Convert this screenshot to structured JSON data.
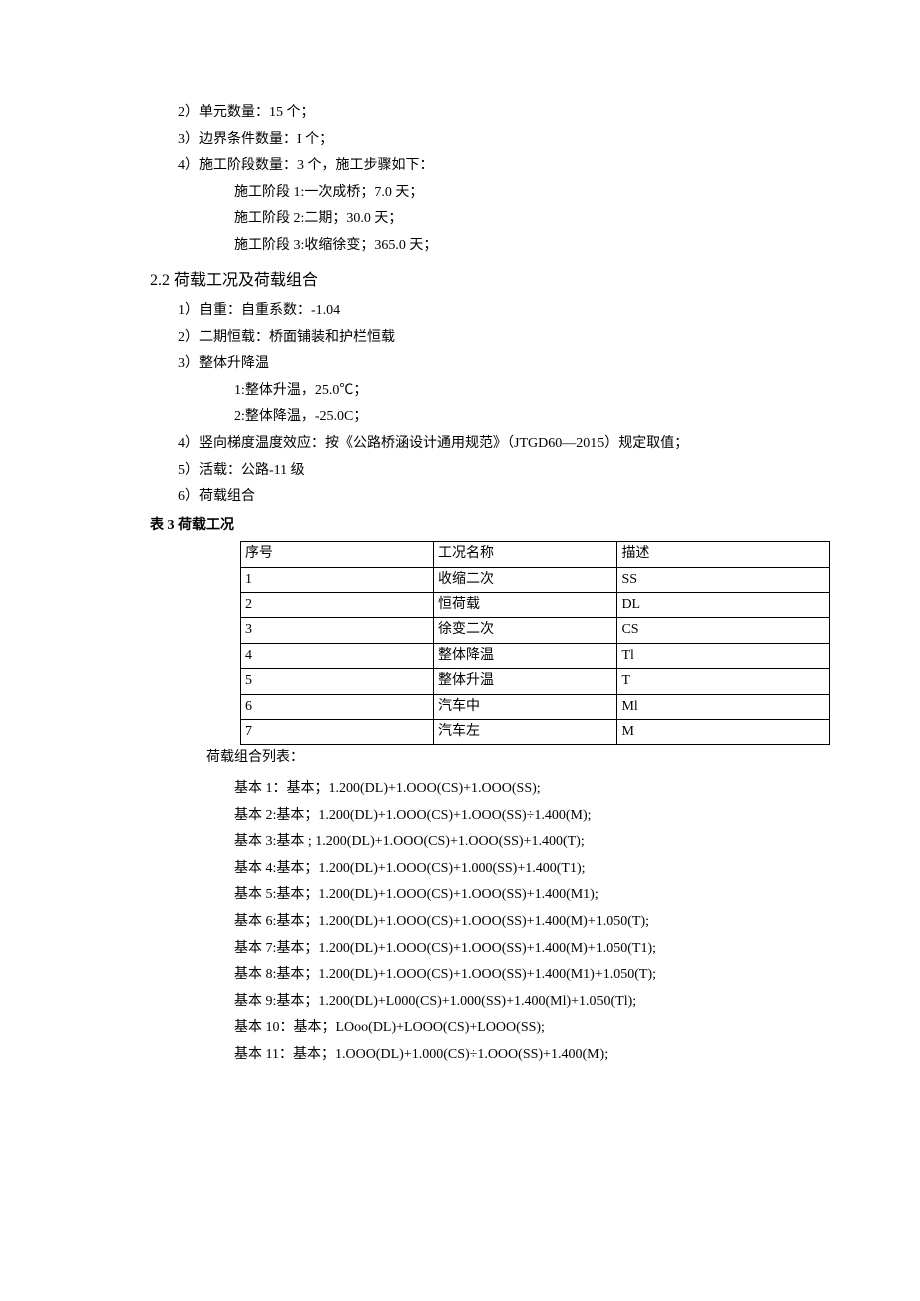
{
  "top": {
    "l1": "2）单元数量：15 个；",
    "l2": "3）边界条件数量：I 个；",
    "l3": "4）施工阶段数量：3 个，施工步骤如下：",
    "l3a": "施工阶段 1:一次成桥；7.0 天；",
    "l3b": "施工阶段 2:二期；30.0 天；",
    "l3c": "施工阶段 3:收缩徐变；365.0 天；"
  },
  "section_heading": "2.2 荷载工况及荷载组合",
  "loads": {
    "l1": "1）自重：自重系数：-1.04",
    "l2": "2）二期恒载：桥面铺装和护栏恒载",
    "l3": "3）整体升降温",
    "l3a": "1:整体升温，25.0℃；",
    "l3b": "2:整体降温，-25.0C；",
    "l4": "4）竖向梯度温度效应：按《公路桥涵设计通用规范》（JTGD60—2015）规定取值；",
    "l5": "5）活载：公路-11 级",
    "l6": "6）荷载组合"
  },
  "table_caption": "表 3 荷载工况",
  "table": {
    "head": {
      "c1": "序号",
      "c2": "工况名称",
      "c3": "描述"
    },
    "rows": [
      {
        "c1": "1",
        "c2": "收缩二次",
        "c3": "SS"
      },
      {
        "c1": "2",
        "c2": "恒荷载",
        "c3": "DL"
      },
      {
        "c1": "3",
        "c2": "徐变二次",
        "c3": "CS"
      },
      {
        "c1": "4",
        "c2": "整体降温",
        "c3": "Tl"
      },
      {
        "c1": "5",
        "c2": "整体升温",
        "c3": "T"
      },
      {
        "c1": "6",
        "c2": "汽车中",
        "c3": "Ml"
      },
      {
        "c1": "7",
        "c2": "汽车左",
        "c3": "M"
      }
    ]
  },
  "combo_title": "荷载组合列表：",
  "combos": [
    "基本 1：基本；1.200(DL)+1.OOO(CS)+1.OOO(SS);",
    "基本 2:基本；1.200(DL)+1.OOO(CS)+1.OOO(SS)÷1.400(M);",
    "基本 3:基本 ; 1.200(DL)+1.OOO(CS)+1.OOO(SS)+1.400(T);",
    "基本 4:基本；1.200(DL)+1.OOO(CS)+1.000(SS)+1.400(T1);",
    "基本 5:基本；1.200(DL)+1.OOO(CS)+1.OOO(SS)+1.400(M1);",
    "基本 6:基本；1.200(DL)+1.OOO(CS)+1.OOO(SS)+1.400(M)+1.050(T);",
    "基本 7:基本；1.200(DL)+1.OOO(CS)+1.OOO(SS)+1.400(M)+1.050(T1);",
    "基本 8:基本；1.200(DL)+1.OOO(CS)+1.OOO(SS)+1.400(M1)+1.050(T);",
    "基本 9:基本；1.200(DL)+L000(CS)+1.000(SS)+1.400(Ml)+1.050(Tl);",
    "基本 10：基本；LOoo(DL)+LOOO(CS)+LOOO(SS);",
    "基本 11：基本；1.OOO(DL)+1.000(CS)÷1.OOO(SS)+1.400(M);"
  ]
}
